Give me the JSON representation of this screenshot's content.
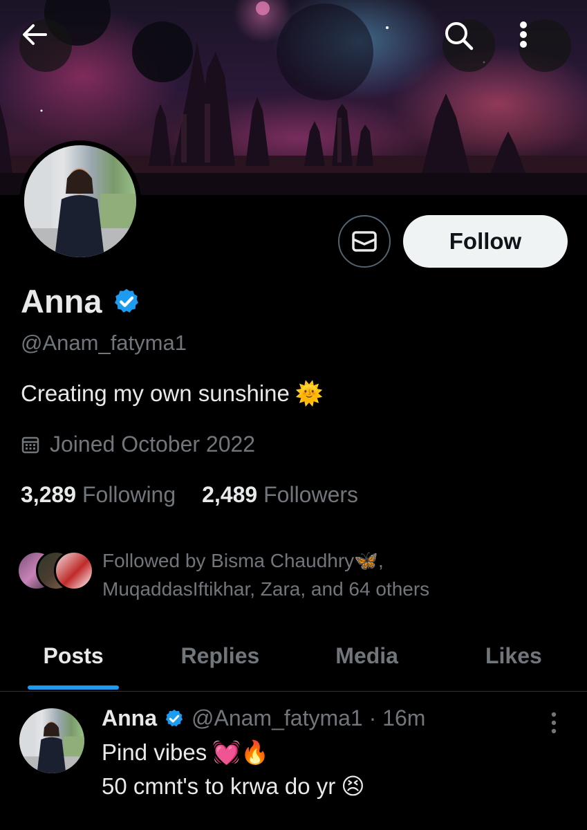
{
  "header": {
    "back_icon": "arrow-left-icon",
    "search_icon": "search-icon",
    "more_icon": "more-vertical-icon"
  },
  "profile": {
    "name": "Anna",
    "verified_icon": "verified-badge-icon",
    "handle": "@Anam_fatyma1",
    "bio_text": "Creating my own sunshine",
    "bio_emoji": "🌞",
    "joined": "Joined October 2022",
    "following_count": "3,289",
    "following_label": "Following",
    "followers_count": "2,489",
    "followers_label": "Followers",
    "followed_by_line1": "Followed by Bisma Chaudhry🦋,",
    "followed_by_line2": "MuqaddasIftikhar, Zara, and 64 others"
  },
  "actions": {
    "message_icon": "envelope-icon",
    "follow_label": "Follow"
  },
  "tabs": [
    {
      "label": "Posts",
      "active": true
    },
    {
      "label": "Replies",
      "active": false
    },
    {
      "label": "Media",
      "active": false
    },
    {
      "label": "Likes",
      "active": false
    }
  ],
  "post": {
    "name": "Anna",
    "meta": "@Anam_fatyma1 · 16m",
    "line1_text": "Pind vibes",
    "line1_emoji": "💓🔥",
    "line2_text": "50 cmnt's to krwa do yr",
    "line2_emoji": "😣"
  },
  "colors": {
    "accent": "#1d9bf0",
    "secondary_text": "#71767b",
    "primary_text": "#e7e9ea",
    "follow_bg": "#eff3f4"
  }
}
